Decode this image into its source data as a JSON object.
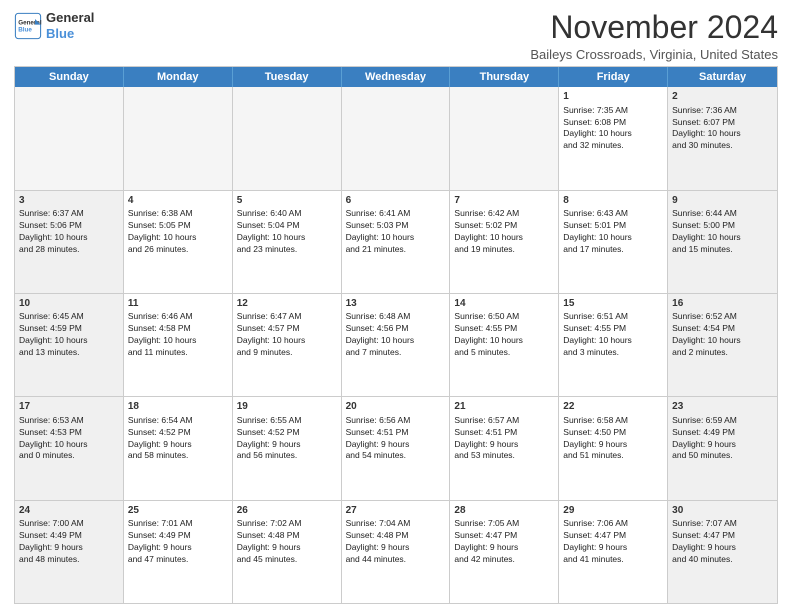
{
  "logo": {
    "line1": "General",
    "line2": "Blue"
  },
  "title": "November 2024",
  "subtitle": "Baileys Crossroads, Virginia, United States",
  "weekdays": [
    "Sunday",
    "Monday",
    "Tuesday",
    "Wednesday",
    "Thursday",
    "Friday",
    "Saturday"
  ],
  "weeks": [
    [
      {
        "day": "",
        "info": "",
        "empty": true
      },
      {
        "day": "",
        "info": "",
        "empty": true
      },
      {
        "day": "",
        "info": "",
        "empty": true
      },
      {
        "day": "",
        "info": "",
        "empty": true
      },
      {
        "day": "",
        "info": "",
        "empty": true
      },
      {
        "day": "1",
        "info": "Sunrise: 7:35 AM\nSunset: 6:08 PM\nDaylight: 10 hours\nand 32 minutes.",
        "empty": false,
        "shaded": false
      },
      {
        "day": "2",
        "info": "Sunrise: 7:36 AM\nSunset: 6:07 PM\nDaylight: 10 hours\nand 30 minutes.",
        "empty": false,
        "shaded": true
      }
    ],
    [
      {
        "day": "3",
        "info": "Sunrise: 6:37 AM\nSunset: 5:06 PM\nDaylight: 10 hours\nand 28 minutes.",
        "empty": false,
        "shaded": true
      },
      {
        "day": "4",
        "info": "Sunrise: 6:38 AM\nSunset: 5:05 PM\nDaylight: 10 hours\nand 26 minutes.",
        "empty": false,
        "shaded": false
      },
      {
        "day": "5",
        "info": "Sunrise: 6:40 AM\nSunset: 5:04 PM\nDaylight: 10 hours\nand 23 minutes.",
        "empty": false,
        "shaded": false
      },
      {
        "day": "6",
        "info": "Sunrise: 6:41 AM\nSunset: 5:03 PM\nDaylight: 10 hours\nand 21 minutes.",
        "empty": false,
        "shaded": false
      },
      {
        "day": "7",
        "info": "Sunrise: 6:42 AM\nSunset: 5:02 PM\nDaylight: 10 hours\nand 19 minutes.",
        "empty": false,
        "shaded": false
      },
      {
        "day": "8",
        "info": "Sunrise: 6:43 AM\nSunset: 5:01 PM\nDaylight: 10 hours\nand 17 minutes.",
        "empty": false,
        "shaded": false
      },
      {
        "day": "9",
        "info": "Sunrise: 6:44 AM\nSunset: 5:00 PM\nDaylight: 10 hours\nand 15 minutes.",
        "empty": false,
        "shaded": true
      }
    ],
    [
      {
        "day": "10",
        "info": "Sunrise: 6:45 AM\nSunset: 4:59 PM\nDaylight: 10 hours\nand 13 minutes.",
        "empty": false,
        "shaded": true
      },
      {
        "day": "11",
        "info": "Sunrise: 6:46 AM\nSunset: 4:58 PM\nDaylight: 10 hours\nand 11 minutes.",
        "empty": false,
        "shaded": false
      },
      {
        "day": "12",
        "info": "Sunrise: 6:47 AM\nSunset: 4:57 PM\nDaylight: 10 hours\nand 9 minutes.",
        "empty": false,
        "shaded": false
      },
      {
        "day": "13",
        "info": "Sunrise: 6:48 AM\nSunset: 4:56 PM\nDaylight: 10 hours\nand 7 minutes.",
        "empty": false,
        "shaded": false
      },
      {
        "day": "14",
        "info": "Sunrise: 6:50 AM\nSunset: 4:55 PM\nDaylight: 10 hours\nand 5 minutes.",
        "empty": false,
        "shaded": false
      },
      {
        "day": "15",
        "info": "Sunrise: 6:51 AM\nSunset: 4:55 PM\nDaylight: 10 hours\nand 3 minutes.",
        "empty": false,
        "shaded": false
      },
      {
        "day": "16",
        "info": "Sunrise: 6:52 AM\nSunset: 4:54 PM\nDaylight: 10 hours\nand 2 minutes.",
        "empty": false,
        "shaded": true
      }
    ],
    [
      {
        "day": "17",
        "info": "Sunrise: 6:53 AM\nSunset: 4:53 PM\nDaylight: 10 hours\nand 0 minutes.",
        "empty": false,
        "shaded": true
      },
      {
        "day": "18",
        "info": "Sunrise: 6:54 AM\nSunset: 4:52 PM\nDaylight: 9 hours\nand 58 minutes.",
        "empty": false,
        "shaded": false
      },
      {
        "day": "19",
        "info": "Sunrise: 6:55 AM\nSunset: 4:52 PM\nDaylight: 9 hours\nand 56 minutes.",
        "empty": false,
        "shaded": false
      },
      {
        "day": "20",
        "info": "Sunrise: 6:56 AM\nSunset: 4:51 PM\nDaylight: 9 hours\nand 54 minutes.",
        "empty": false,
        "shaded": false
      },
      {
        "day": "21",
        "info": "Sunrise: 6:57 AM\nSunset: 4:51 PM\nDaylight: 9 hours\nand 53 minutes.",
        "empty": false,
        "shaded": false
      },
      {
        "day": "22",
        "info": "Sunrise: 6:58 AM\nSunset: 4:50 PM\nDaylight: 9 hours\nand 51 minutes.",
        "empty": false,
        "shaded": false
      },
      {
        "day": "23",
        "info": "Sunrise: 6:59 AM\nSunset: 4:49 PM\nDaylight: 9 hours\nand 50 minutes.",
        "empty": false,
        "shaded": true
      }
    ],
    [
      {
        "day": "24",
        "info": "Sunrise: 7:00 AM\nSunset: 4:49 PM\nDaylight: 9 hours\nand 48 minutes.",
        "empty": false,
        "shaded": true
      },
      {
        "day": "25",
        "info": "Sunrise: 7:01 AM\nSunset: 4:49 PM\nDaylight: 9 hours\nand 47 minutes.",
        "empty": false,
        "shaded": false
      },
      {
        "day": "26",
        "info": "Sunrise: 7:02 AM\nSunset: 4:48 PM\nDaylight: 9 hours\nand 45 minutes.",
        "empty": false,
        "shaded": false
      },
      {
        "day": "27",
        "info": "Sunrise: 7:04 AM\nSunset: 4:48 PM\nDaylight: 9 hours\nand 44 minutes.",
        "empty": false,
        "shaded": false
      },
      {
        "day": "28",
        "info": "Sunrise: 7:05 AM\nSunset: 4:47 PM\nDaylight: 9 hours\nand 42 minutes.",
        "empty": false,
        "shaded": false
      },
      {
        "day": "29",
        "info": "Sunrise: 7:06 AM\nSunset: 4:47 PM\nDaylight: 9 hours\nand 41 minutes.",
        "empty": false,
        "shaded": false
      },
      {
        "day": "30",
        "info": "Sunrise: 7:07 AM\nSunset: 4:47 PM\nDaylight: 9 hours\nand 40 minutes.",
        "empty": false,
        "shaded": true
      }
    ]
  ]
}
